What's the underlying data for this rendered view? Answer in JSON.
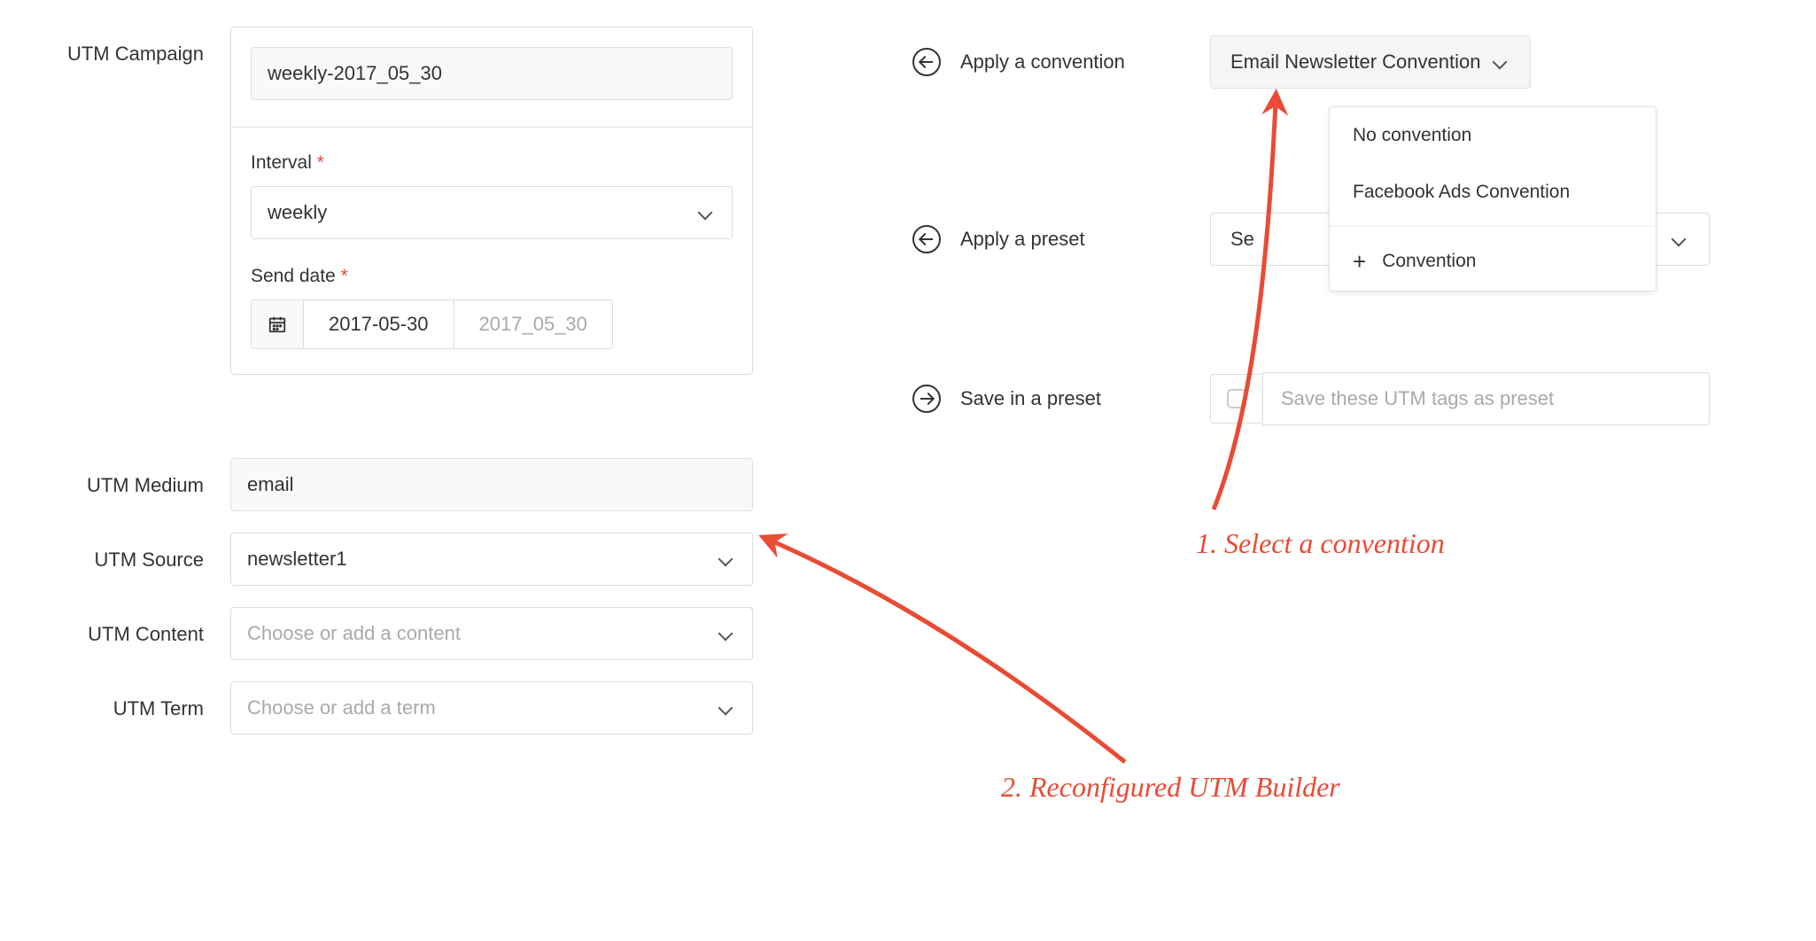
{
  "left": {
    "utm_campaign": {
      "label": "UTM Campaign",
      "value": "weekly-2017_05_30",
      "interval_label": "Interval",
      "interval_value": "weekly",
      "send_date_label": "Send date",
      "send_date_value": "2017-05-30",
      "send_date_slug": "2017_05_30"
    },
    "utm_medium": {
      "label": "UTM Medium",
      "value": "email"
    },
    "utm_source": {
      "label": "UTM Source",
      "value": "newsletter1"
    },
    "utm_content": {
      "label": "UTM Content",
      "placeholder": "Choose or add a content"
    },
    "utm_term": {
      "label": "UTM Term",
      "placeholder": "Choose or add a term"
    }
  },
  "right": {
    "apply_convention": {
      "label": "Apply a convention",
      "selected": "Email Newsletter Convention",
      "options": {
        "none": "No convention",
        "fb": "Facebook Ads Convention",
        "add": "Convention"
      }
    },
    "apply_preset": {
      "label": "Apply a preset",
      "selected_partial": "Se"
    },
    "save_preset": {
      "label": "Save in a preset",
      "placeholder": "Save these UTM tags as preset"
    }
  },
  "annotations": {
    "step1": "1. Select a convention",
    "step2": "2. Reconfigured UTM Builder"
  }
}
